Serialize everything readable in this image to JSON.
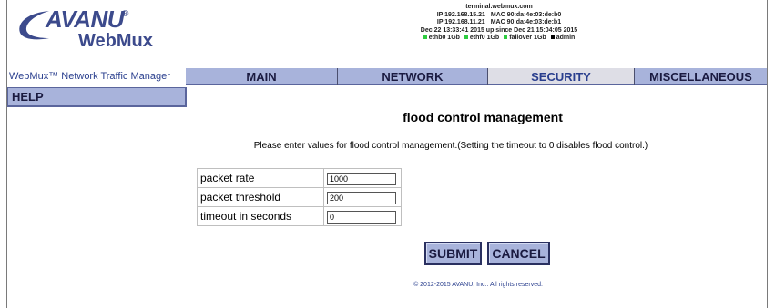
{
  "logo": {
    "brand": "AVANU",
    "reg": "®",
    "product": "WebMux"
  },
  "sysinfo": {
    "host": "terminal.webmux.com",
    "ip1": "IP 192.168.15.21",
    "mac1": "MAC 90:da:4e:03:de:b0",
    "ip2": "IP 192.168.11.21",
    "mac2": "MAC 90:da:4e:03:de:b1",
    "uptime": "Dec 22 13:33:41 2015 up since Dec 21 15:04:05 2015",
    "ports": [
      {
        "label": "ethb0 1Gb",
        "color": "#2ecc40"
      },
      {
        "label": "ethf0 1Gb",
        "color": "#2ecc40"
      },
      {
        "label": "failover 1Gb",
        "color": "#2ecc40"
      },
      {
        "label": "admin",
        "color": "#000000"
      }
    ]
  },
  "nav": {
    "brand": "WebMux™ Network Traffic Manager",
    "tabs": [
      {
        "label": "MAIN",
        "active": false
      },
      {
        "label": "NETWORK",
        "active": false
      },
      {
        "label": "SECURITY",
        "active": true
      },
      {
        "label": "MISCELLANEOUS",
        "active": false
      }
    ]
  },
  "help_label": "HELP",
  "main": {
    "title": "flood control management",
    "instructions": "Please enter values for flood control management.(Setting the timeout to 0 disables flood control.)",
    "fields": [
      {
        "label": "packet rate",
        "value": "1000"
      },
      {
        "label": "packet threshold",
        "value": "200"
      },
      {
        "label": "timeout in seconds",
        "value": "0"
      }
    ],
    "submit_label": "SUBMIT",
    "cancel_label": "CANCEL"
  },
  "footer": "© 2012-2015 AVANU, Inc.. All rights reserved."
}
